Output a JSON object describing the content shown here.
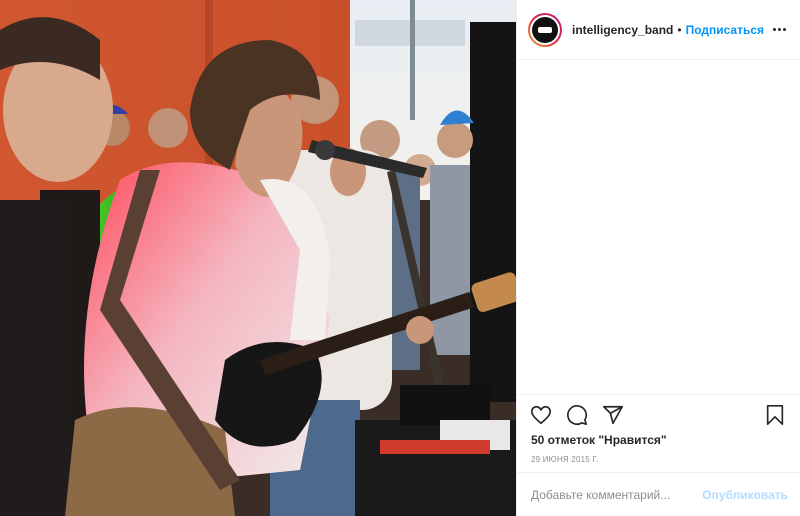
{
  "post": {
    "username": "intelligency_band",
    "separator": "•",
    "follow_label": "Подписаться",
    "likes_text": "50 отметок \"Нравится\"",
    "date_text": "29 ИЮНЯ 2015 Г.",
    "comment_placeholder": "Добавьте комментарий...",
    "publish_label": "Опубликовать"
  },
  "icons": {
    "like": "heart-icon",
    "comment": "comment-icon",
    "share": "share-icon",
    "save": "bookmark-icon",
    "more": "more-options-icon"
  },
  "colors": {
    "accent": "#0095f6",
    "publish_disabled": "#b3dbff",
    "muted": "#8e8e8e"
  }
}
